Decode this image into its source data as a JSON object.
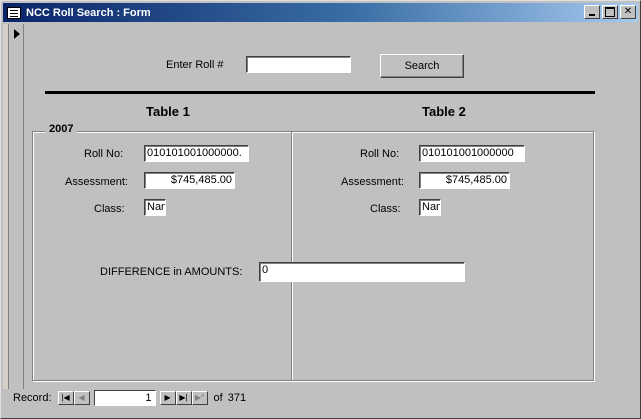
{
  "window": {
    "title": "NCC Roll Search : Form"
  },
  "search": {
    "label": "Enter Roll #",
    "value": "",
    "button_label": "Search"
  },
  "tables": {
    "table1_title": "Table 1",
    "table2_title": "Table 2"
  },
  "group": {
    "label": "2007"
  },
  "table1": {
    "roll_label": "Roll No:",
    "roll_value": "010101001000000.",
    "assessment_label": "Assessment:",
    "assessment_value": "$745,485.00",
    "class_label": "Class:",
    "class_value": "Nam"
  },
  "table2": {
    "roll_label": "Roll No:",
    "roll_value": "010101001000000",
    "assessment_label": "Assessment:",
    "assessment_value": "$745,485.00",
    "class_label": "Class:",
    "class_value": "Nam"
  },
  "difference": {
    "label": "DIFFERENCE in AMOUNTS:",
    "value": "0"
  },
  "navigation": {
    "record_label": "Record:",
    "current": "1",
    "of_label": "of",
    "total": "371"
  },
  "icons": {
    "first": "first-record-icon",
    "prev": "previous-record-icon",
    "next": "next-record-icon",
    "last": "last-record-icon",
    "new": "new-record-icon"
  },
  "colors": {
    "title_bar_start": "#0a246a",
    "title_bar_end": "#a6caf0",
    "face": "#c0c0c0"
  }
}
